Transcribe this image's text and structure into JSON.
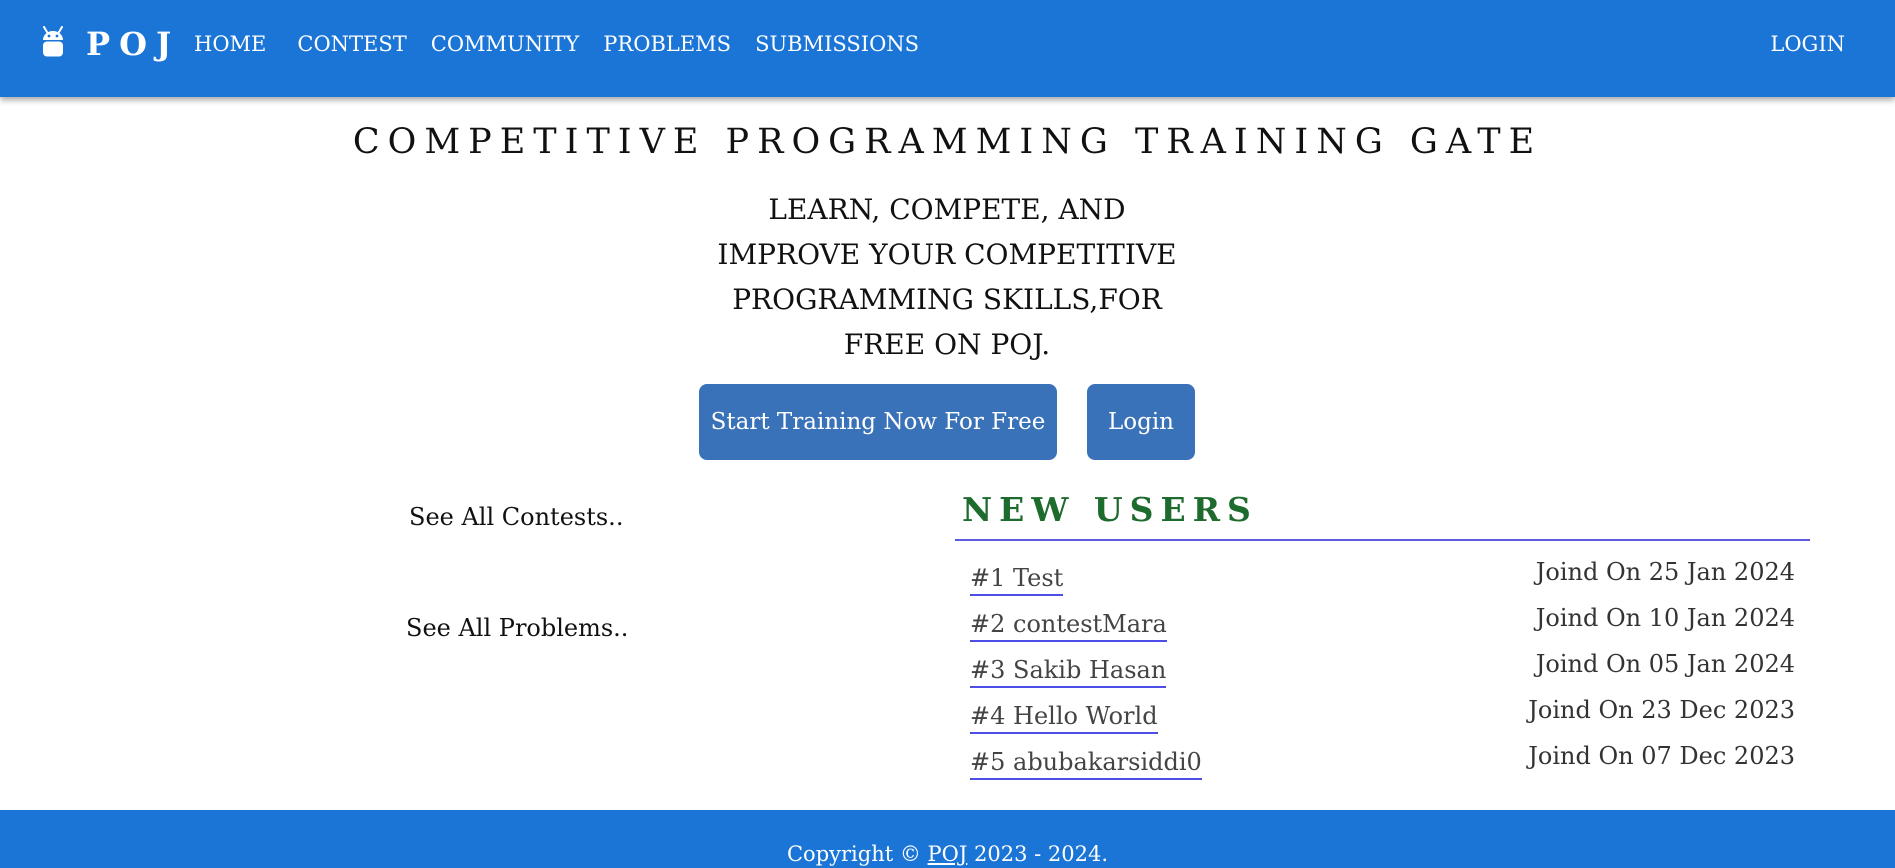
{
  "nav": {
    "brand": "POJ",
    "brand_icon": "android-robot-icon",
    "links": [
      "HOME",
      "CONTEST",
      "COMMUNITY",
      "PROBLEMS",
      "SUBMISSIONS"
    ],
    "login": "LOGIN"
  },
  "hero": {
    "title": "COMPETITIVE PROGRAMMING TRAINING GATE",
    "subtitle": "LEARN, COMPETE, AND IMPROVE YOUR COMPETITIVE PROGRAMMING SKILLS,FOR FREE ON POJ.",
    "start_button": "Start Training Now For Free",
    "login_button": "Login"
  },
  "side": {
    "contests_link": "See All Contests..",
    "problems_link": "See All Problems.."
  },
  "new_users": {
    "title": "NEW USERS",
    "users": [
      {
        "name": "#1 Test",
        "joined": "Joind On 25 Jan 2024"
      },
      {
        "name": "#2 contestMara",
        "joined": "Joind On 10 Jan 2024"
      },
      {
        "name": "#3 Sakib Hasan",
        "joined": "Joind On 05 Jan 2024"
      },
      {
        "name": "#4 Hello World",
        "joined": "Joind On 23 Dec 2023"
      },
      {
        "name": "#5 abubakarsiddi0",
        "joined": "Joind On 07 Dec 2023"
      }
    ]
  },
  "footer": {
    "prefix": "Copyright ©",
    "link": "POJ",
    "suffix": "2023 - 2024."
  },
  "colors": {
    "primary": "#1b75d6",
    "button": "#3a72b9",
    "section_title": "#1e6b2e",
    "rule": "#5b5be0"
  }
}
